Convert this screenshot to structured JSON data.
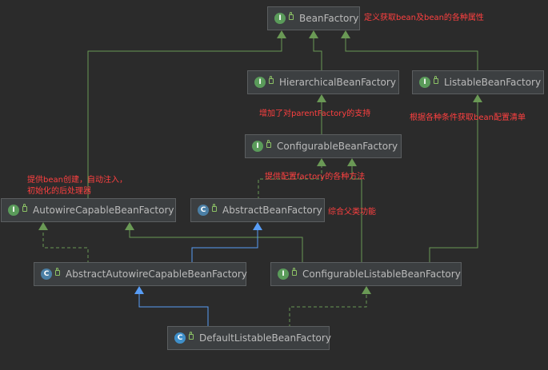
{
  "colors": {
    "background": "#2b2b2b",
    "node_fill": "#3c3f41",
    "node_border": "#5b5e60",
    "extends_edge": "#589df6",
    "implements_edge": "#6a9955",
    "interface_edge": "#6a9955",
    "note_text": "#ff4040"
  },
  "icons": {
    "interface": "I",
    "abstract_class": "C",
    "class": "C"
  },
  "nodes": {
    "bean_factory": "BeanFactory",
    "hierarchical_bean_factory": "HierarchicalBeanFactory",
    "listable_bean_factory": "ListableBeanFactory",
    "configurable_bean_factory": "ConfigurableBeanFactory",
    "autowire_capable_bean_factory": "AutowireCapableBeanFactory",
    "abstract_bean_factory": "AbstractBeanFactory",
    "abstract_autowire_capable_bean_factory": "AbstractAutowireCapableBeanFactory",
    "configurable_listable_bean_factory": "ConfigurableListableBeanFactory",
    "default_listable_bean_factory": "DefaultListableBeanFactory"
  },
  "notes": {
    "bean_factory": "定义获取bean及bean的各种属性",
    "hierarchical": "增加了对parentFactory的支持",
    "listable": "根据各种条件获取bean配置清单",
    "configurable": "提供配置factory的各种方法",
    "autowire_line1": "提供bean创建，自动注入，",
    "autowire_line2": "初始化的后处理器",
    "abstract_bean_factory": "综合父类功能"
  }
}
